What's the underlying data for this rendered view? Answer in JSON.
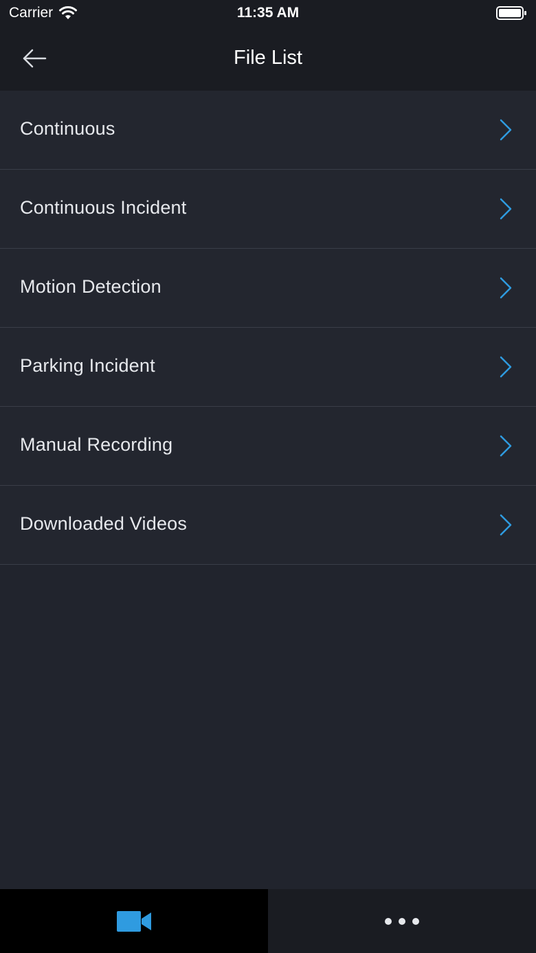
{
  "status_bar": {
    "carrier": "Carrier",
    "time": "11:35 AM",
    "icons": [
      "wifi-icon",
      "battery-icon"
    ]
  },
  "nav": {
    "title": "File List",
    "back_icon": "arrow-left-icon"
  },
  "file_categories": [
    {
      "label": "Continuous"
    },
    {
      "label": "Continuous Incident"
    },
    {
      "label": "Motion Detection"
    },
    {
      "label": "Parking Incident"
    },
    {
      "label": "Manual Recording"
    },
    {
      "label": "Downloaded Videos"
    }
  ],
  "tab_bar": {
    "tabs": [
      {
        "icon": "video-camera-icon",
        "selected": true
      },
      {
        "icon": "more-icon",
        "selected": false
      }
    ]
  },
  "colors": {
    "accent": "#2f9be0",
    "header_bg": "#1a1c22",
    "list_bg": "#23262f",
    "divider": "#3a3e48",
    "text": "#e6e8ec"
  }
}
